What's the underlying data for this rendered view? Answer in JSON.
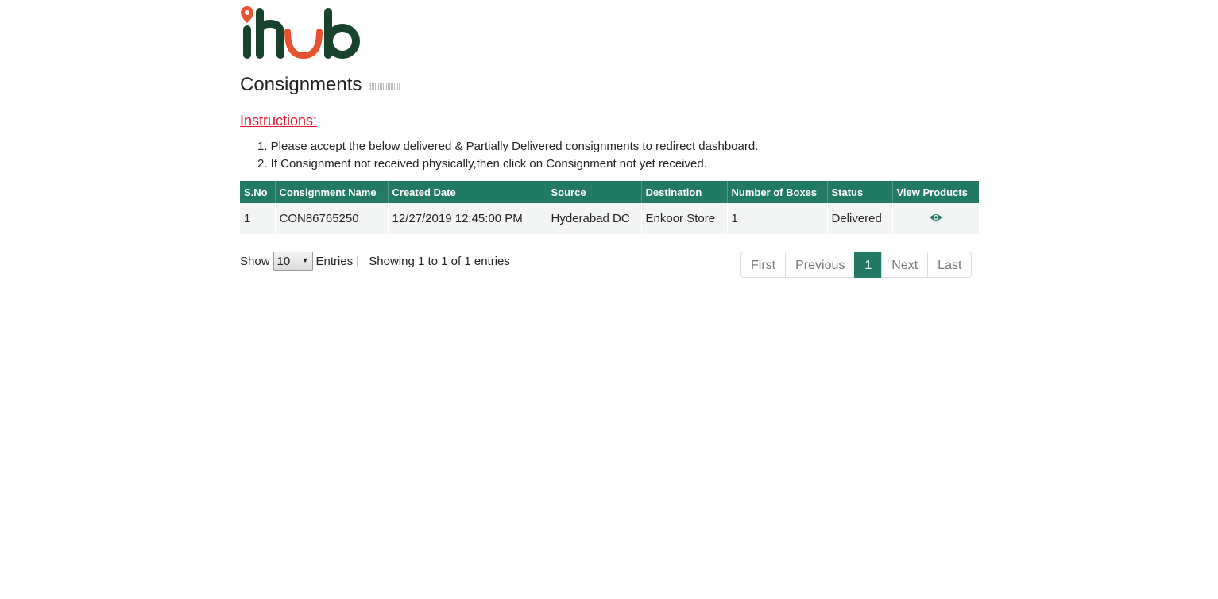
{
  "brand": {
    "logo_text": "ihub",
    "colors": {
      "primary": "#217a64",
      "dark_green": "#17432d",
      "accent": "#e8532f",
      "alert": "#e8192c"
    }
  },
  "page": {
    "title": "Consignments"
  },
  "instructions": {
    "heading": "Instructions:",
    "items": [
      "1. Please accept the below delivered & Partially Delivered consignments to redirect dashboard.",
      "2. If Consignment not received physically,then click on Consignment not yet received."
    ]
  },
  "table": {
    "headers": [
      "S.No",
      "Consignment Name",
      "Created Date",
      "Source",
      "Destination",
      "Number of Boxes",
      "Status",
      "View Products"
    ],
    "rows": [
      {
        "sno": "1",
        "name": "CON86765250",
        "created": "12/27/2019 12:45:00 PM",
        "source": "Hyderabad DC",
        "destination": "Enkoor Store",
        "boxes": "1",
        "status": "Delivered",
        "view_icon": "eye-icon"
      }
    ]
  },
  "footer": {
    "show_label": "Show",
    "page_size": "10",
    "entries_label": "Entries |",
    "showing_text": "Showing 1 to 1 of 1 entries"
  },
  "pagination": {
    "first": "First",
    "previous": "Previous",
    "current": "1",
    "next": "Next",
    "last": "Last"
  }
}
